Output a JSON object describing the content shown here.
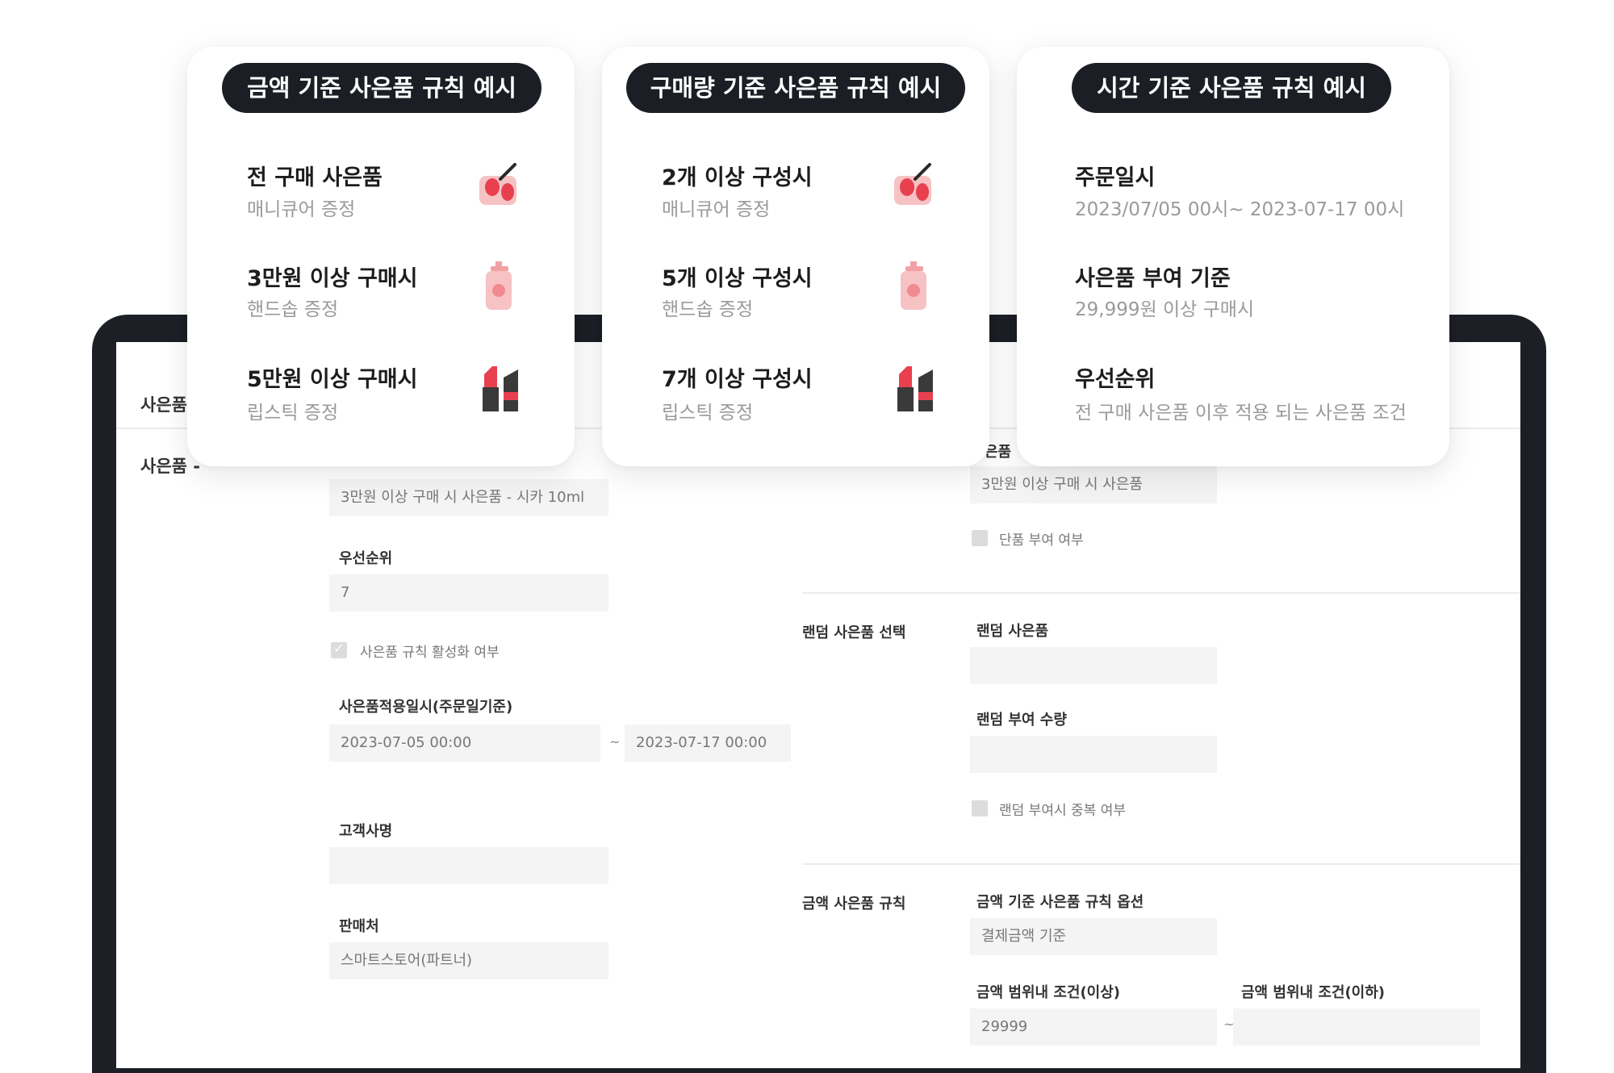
{
  "cards": [
    {
      "pill": "금액 기준 사은품 규칙 예시",
      "items": [
        {
          "title": "전 구매 사은품",
          "sub": "매니큐어 증정",
          "icon": "nail-polish-icon"
        },
        {
          "title": "3만원 이상 구매시",
          "sub": "핸드솝 증정",
          "icon": "hand-soap-icon"
        },
        {
          "title": "5만원 이상 구매시",
          "sub": "립스틱 증정",
          "icon": "lipstick-icon"
        }
      ]
    },
    {
      "pill": "구매량 기준 사은품 규칙 예시",
      "items": [
        {
          "title": "2개 이상 구성시",
          "sub": "매니큐어 증정",
          "icon": "nail-polish-icon"
        },
        {
          "title": "5개 이상 구성시",
          "sub": "핸드솝 증정",
          "icon": "hand-soap-icon"
        },
        {
          "title": "7개 이상 구성시",
          "sub": "립스틱 증정",
          "icon": "lipstick-icon"
        }
      ]
    },
    {
      "pill": "시간 기준 사은품 규칙 예시",
      "items": [
        {
          "title": "주문일시",
          "sub": "2023/07/05 00시~ 2023-07-17 00시"
        },
        {
          "title": "사은품 부여 기준",
          "sub": "29,999원 이상 구매시"
        },
        {
          "title": "우선순위",
          "sub": "전 구매 사은품 이후 적용 되는 사은품 조건"
        }
      ]
    }
  ],
  "form": {
    "side_labels": [
      "사은품",
      "사은품 -"
    ],
    "gift_name_value": "3만원 이상 구매 시 사은품 - 시카 10ml",
    "priority_label": "우선순위",
    "priority_value": "7",
    "active_checkbox_label": "사은품 규칙 활성화 여부",
    "active_checked": true,
    "apply_date_label": "사은품적용일시(주문일기준)",
    "date_from": "2023-07-05 00:00",
    "date_sep": "~",
    "date_to": "2023-07-17 00:00",
    "customer_label": "고객사명",
    "customer_value": "",
    "seller_label": "판매처",
    "seller_value": "스마트스토어(파트너)",
    "right_gift_label": "은품",
    "right_gift_value": "3만원 이상 구매 시 사은품",
    "single_grant_label": "단품 부여 여부",
    "random_section": "랜덤 사은품 선택",
    "random_gift_label": "랜덤 사은품",
    "random_gift_value": "",
    "random_qty_label": "랜덤 부여 수량",
    "random_qty_value": "",
    "random_dup_label": "랜덤 부여시 중복 여부",
    "amount_section": "금액 사은품 규칙",
    "amount_option_label": "금액 기준 사은품 규칙 옵션",
    "amount_option_value": "결제금액 기준",
    "amount_min_label": "금액 범위내 조건(이상)",
    "amount_min_value": "29999",
    "amount_sep": "~",
    "amount_max_label": "금액 범위내 조건(이하)",
    "amount_max_value": ""
  },
  "colors": {
    "pill_bg": "#1b1e25",
    "frame": "#1c1f26",
    "accent_red": "#e8404f",
    "pink": "#f3a0a4"
  }
}
